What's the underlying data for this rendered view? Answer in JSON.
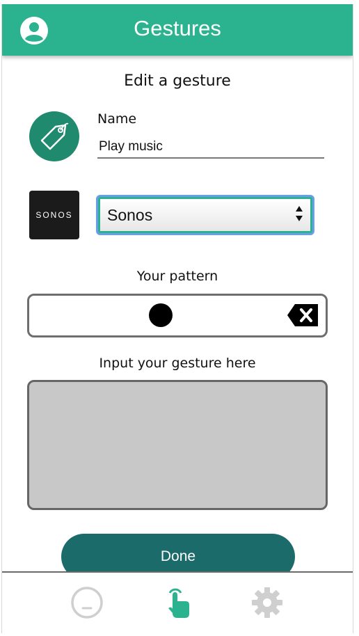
{
  "app": {
    "title": "Gestures",
    "accent_color": "#2bb38f",
    "dark_accent_color": "#1a6b6a"
  },
  "header": {
    "title": "Gestures",
    "profile_icon": "account-circle-icon"
  },
  "form": {
    "heading": "Edit a gesture",
    "name_label": "Name",
    "name_value": "Play music",
    "tag_icon": "tag-icon",
    "device_logo_text": "SONOS",
    "device_select": {
      "selected": "Sonos"
    },
    "pattern_label": "Your pattern",
    "pattern": {
      "dots": 1,
      "clear_icon": "backspace-icon"
    },
    "gesture_input_label": "Input your gesture here",
    "done_label": "Done"
  },
  "bottom_nav": {
    "items": [
      {
        "icon": "neutral-face-icon",
        "active": false
      },
      {
        "icon": "touch-gesture-icon",
        "active": true
      },
      {
        "icon": "settings-gear-icon",
        "active": false
      }
    ]
  }
}
